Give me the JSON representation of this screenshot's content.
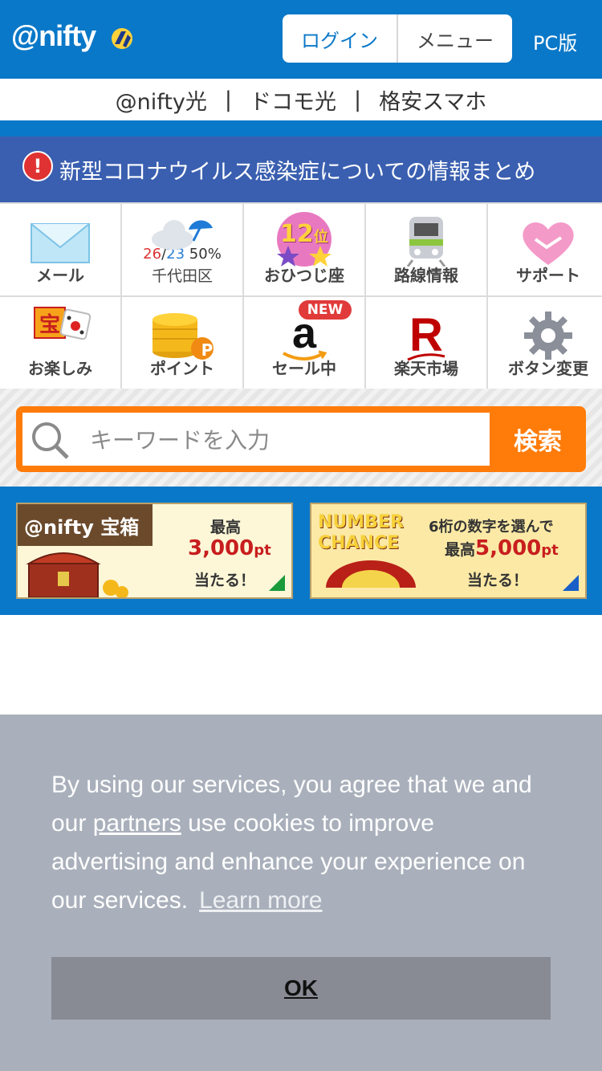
{
  "header": {
    "logo": "@nifty",
    "login_label": "ログイン",
    "menu_label": "メニュー",
    "pc_label": "PC版"
  },
  "service_links": [
    "@nifty光",
    "ドコモ光",
    "格安スマホ"
  ],
  "service_sep": "|",
  "notice": {
    "badge": "!",
    "text": "新型コロナウイルス感染症についての情報まとめ"
  },
  "grid": {
    "mail": "メール",
    "weather_high": "26",
    "weather_slash": "/",
    "weather_low": "23",
    "weather_rain": "50%",
    "weather_location": "千代田区",
    "horoscope_rank_num": "12",
    "horoscope_rank_unit": "位",
    "horoscope": "おひつじ座",
    "train": "路線情報",
    "support": "サポート",
    "fun_badge": "宝",
    "fun": "お楽しみ",
    "points_badge": "P",
    "points": "ポイント",
    "sale_new": "NEW",
    "sale_logo": "a",
    "sale": "セール中",
    "rakuten_logo": "R",
    "rakuten": "楽天市場",
    "settings": "ボタン変更"
  },
  "search": {
    "placeholder": "キーワードを入力",
    "button": "検索"
  },
  "banners": {
    "b1_head": "@nifty 宝箱",
    "b1_line1": "最高",
    "b1_amount": "3,000",
    "b1_unit": "pt",
    "b1_line3": "当たる！",
    "b2_logo_line1": "NUMBER",
    "b2_logo_line2": "CHANCE",
    "b2_line1": "6桁の数字を選んで",
    "b2_prefix": "最高",
    "b2_amount": "5,000",
    "b2_unit": "pt",
    "b2_line3": "当たる！"
  },
  "cookie": {
    "text_before": "By using our services, you agree that we and our ",
    "partners": "partners",
    "text_after": " use cookies to improve advertising and enhance your experience on our services.",
    "learn_more": "Learn more",
    "ok": "OK"
  },
  "colors": {
    "brand_blue": "#0a78c8",
    "notice_blue": "#3a5fb0",
    "search_orange": "#ff7c0a",
    "alert_red": "#e03232"
  }
}
